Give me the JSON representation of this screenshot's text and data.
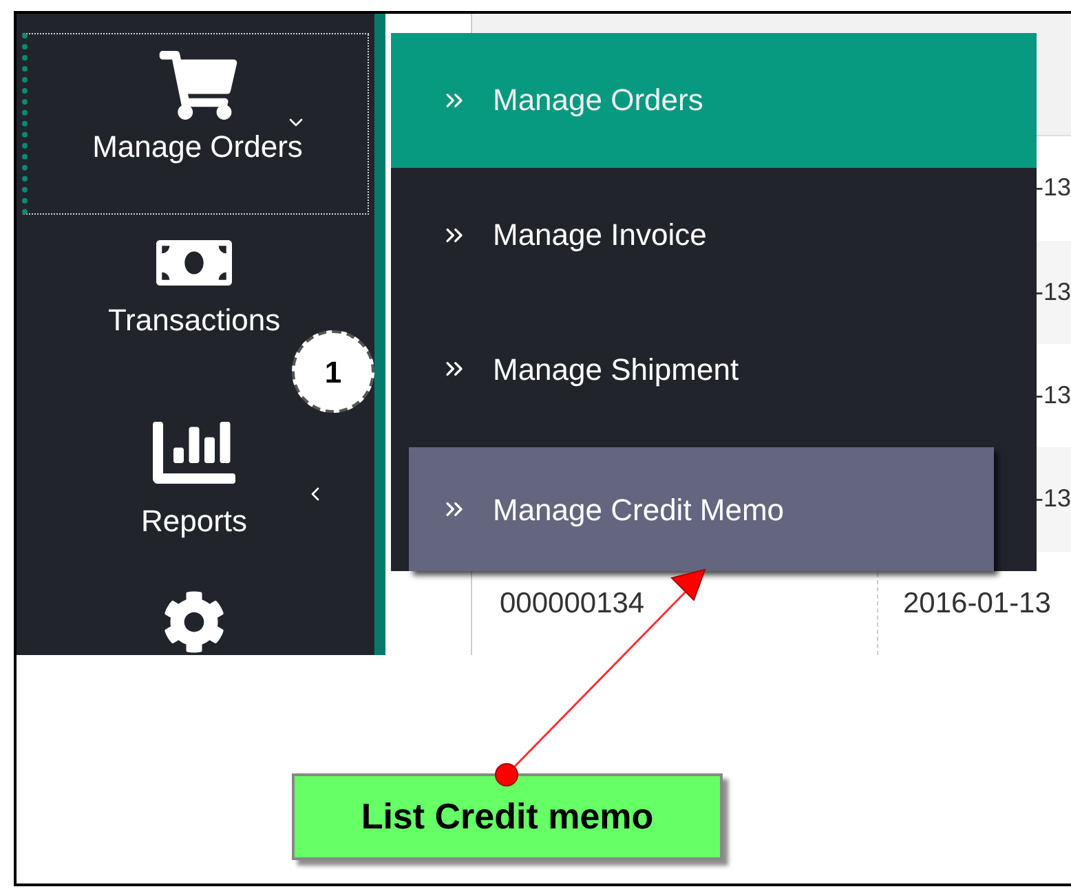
{
  "sidebar": {
    "items": [
      {
        "label": "Manage Orders",
        "kind": "menu",
        "selected": true,
        "expanded": true
      },
      {
        "label": "Transactions",
        "kind": "link",
        "selected": false
      },
      {
        "label": "Reports",
        "kind": "menu",
        "selected": false,
        "expanded": false
      },
      {
        "kind": "link",
        "selected": false
      }
    ]
  },
  "table": {
    "rows": [
      {
        "kind": "covered",
        "column_2": "-13"
      },
      {
        "kind": "covered",
        "column_2": "-13"
      },
      {
        "kind": "covered",
        "column_2": "-13"
      },
      {
        "kind": "covered",
        "column_2": "-13"
      },
      {
        "kind": "full",
        "column_1": "000000134",
        "column_2": "2016-01-13"
      }
    ]
  },
  "submenu": {
    "items": [
      {
        "label": "Manage Orders",
        "selected": true,
        "hovered": false
      },
      {
        "label": "Manage Invoice",
        "selected": false,
        "hovered": false
      },
      {
        "label": "Manage Shipment",
        "selected": false,
        "hovered": false
      },
      {
        "label": "Manage Credit Memo",
        "selected": false,
        "hovered": true
      }
    ]
  },
  "step_badge": "1",
  "callout": "List Credit memo"
}
